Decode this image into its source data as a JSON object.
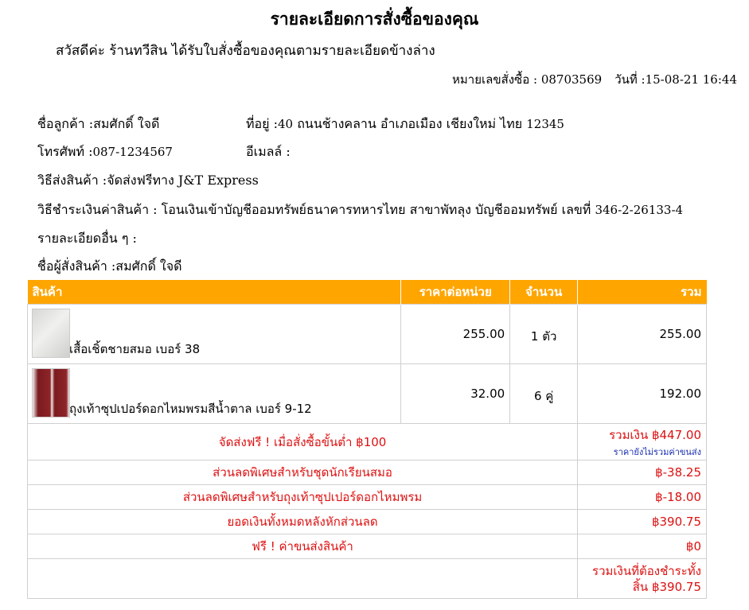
{
  "title": "รายละเอียดการสั่งซื้อของคุณ",
  "greeting": "สวัสดีค่ะ ร้านทวีสิน ได้รับใบสั่งซื้อของคุณตามรายละเอียดข้างล่าง",
  "order": {
    "number_label": "หมายเลขสั่งซื้อ : ",
    "number": "08703569",
    "date_label": "วันที่ :",
    "date": "15-08-21 16:44"
  },
  "customer": {
    "name_label": "ชื่อลูกค้า :",
    "name": "สมศักดิ์ ใจดี",
    "address_label": "ที่อยู่ :",
    "address_no": "40",
    "address": " ถนนช้างคลาน อำเภอเมือง เชียงใหม่ ไทย ",
    "postcode": "12345",
    "phone_label": "โทรศัพท์ :",
    "phone": "087-1234567",
    "email_label": "อีเมลล์ :",
    "email": ""
  },
  "shipping": {
    "label": "วิธีส่งสินค้า :",
    "value": "จัดส่งฟรีทาง J&T Express"
  },
  "payment": {
    "label": "วิธีชำระเงินค่าสินค้า : ",
    "value": "โอนเงินเข้าบัญชีออมทรัพย์ธนาคารทหารไทย สาขาพัทลุง บัญชีออมทรัพย์ เลขที่ ",
    "account": "346-2-26133-4"
  },
  "other": {
    "label": "รายละเอียดอื่น ๆ :",
    "value": ""
  },
  "orderer": {
    "label": "ชื่อผู้สั่งสินค้า :",
    "name": "สมศักดิ์ ใจดี"
  },
  "table": {
    "headers": [
      "สินค้า",
      "ราคาต่อหน่วย",
      "จำนวน",
      "รวม"
    ],
    "rows": [
      {
        "name": "เสื้อเชิ้ตชายสมอ เบอร์ 38",
        "price": "255.00",
        "qty": "1 ตัว",
        "total": "255.00"
      },
      {
        "name": "ถุงเท้าซุปเปอร์ดอกไหมพรมสีน้ำตาล เบอร์ 9-12",
        "price": "32.00",
        "qty": "6 คู่",
        "total": "192.00"
      }
    ]
  },
  "summary": {
    "free_ship_note": "จัดส่งฟรี ! เมื่อสั่งซื้อขั้นต่ำ ฿100",
    "subtotal": "รวมเงิน ฿447.00",
    "subtotal_note": "ราคายังไม่รวมค่าขนส่ง",
    "discount1_label": "ส่วนลดพิเศษสำหรับชุดนักเรียนสมอ",
    "discount1_value": "฿-38.25",
    "discount2_label": "ส่วนลดพิเศษสำหรับถุงเท้าซุปเปอร์ดอกไหมพรม",
    "discount2_value": "฿-18.00",
    "after_discount_label": "ยอดเงินทั้งหมดหลังหักส่วนลด",
    "after_discount_value": "฿390.75",
    "shipping_label": "ฟรี ! ค่าขนส่งสินค้า",
    "shipping_value": "฿0",
    "grand_total": "รวมเงินที่ต้องชำระทั้งสิ้น ฿390.75"
  }
}
